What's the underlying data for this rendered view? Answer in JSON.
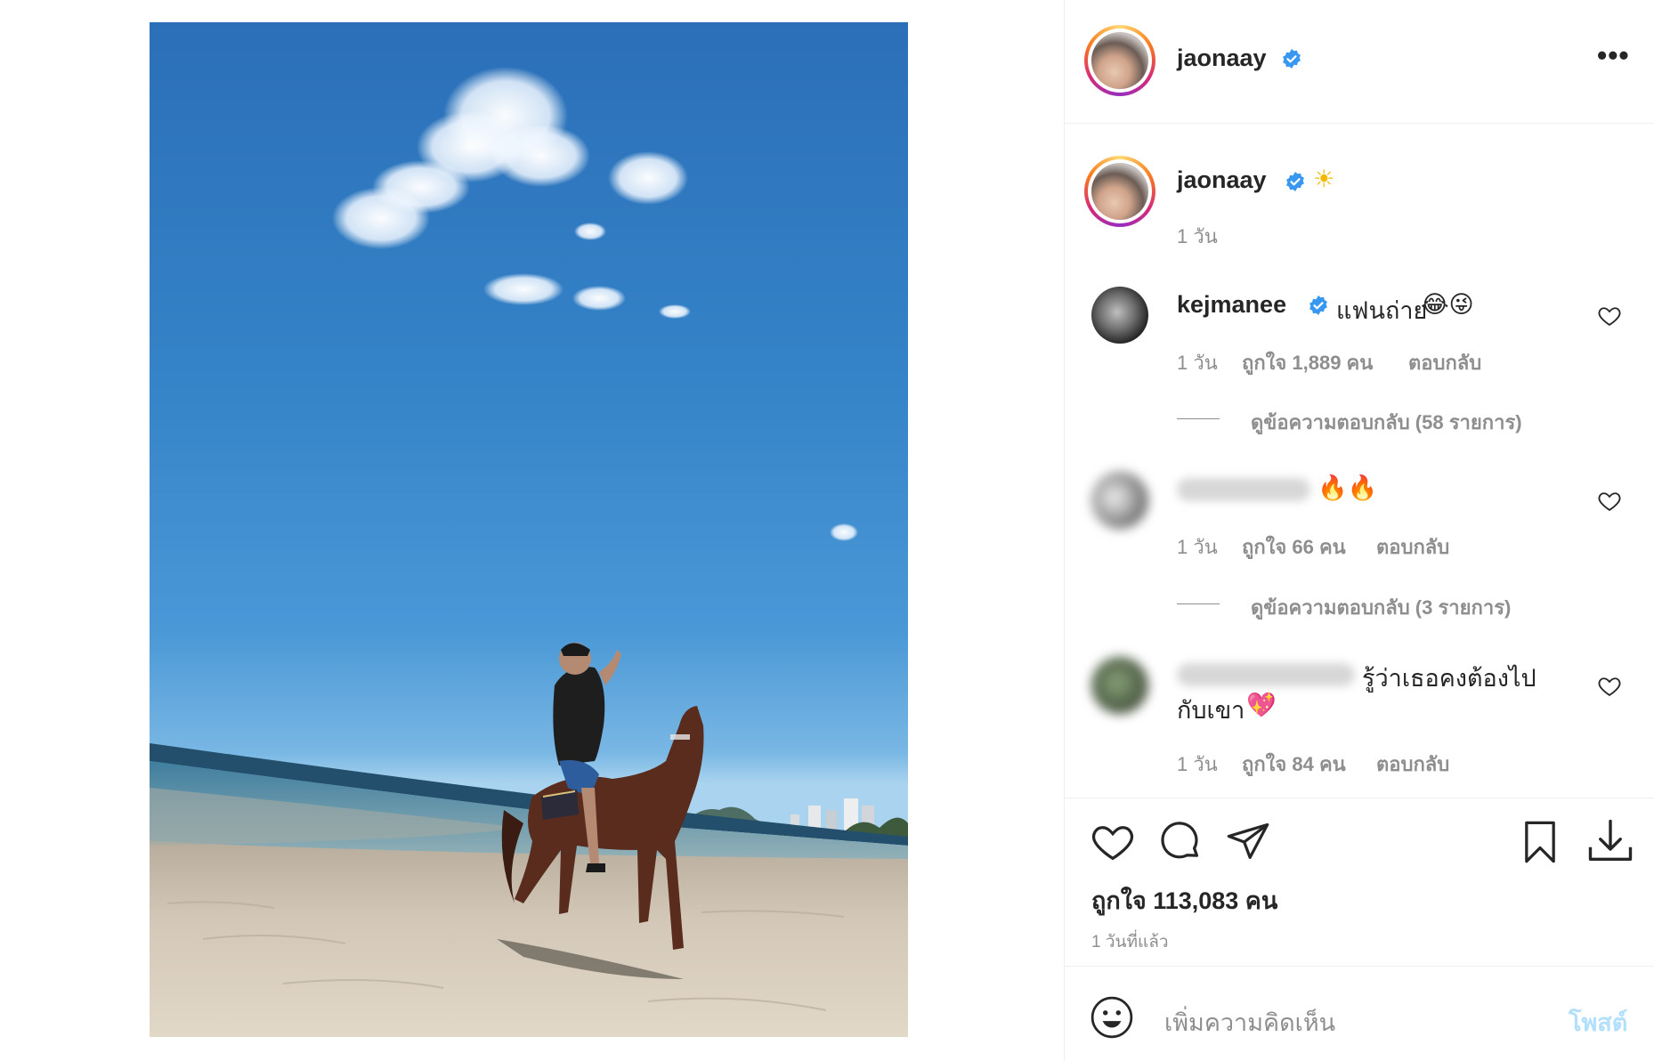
{
  "post": {
    "author": "jaonaay",
    "caption_emoji": "☀",
    "caption_time": "1 วัน",
    "more_label": "•••"
  },
  "comments": [
    {
      "user": "kejmanee",
      "text": "แฟนถ่าย",
      "emoji": "😂😜",
      "time": "1 วัน",
      "likes": "ถูกใจ 1,889 คน",
      "reply_label": "ตอบกลับ",
      "view_replies": "ดูข้อความตอบกลับ (58 รายการ)"
    },
    {
      "emoji": "🔥🔥",
      "time": "1 วัน",
      "likes": "ถูกใจ 66 คน",
      "reply_label": "ตอบกลับ",
      "view_replies": "ดูข้อความตอบกลับ (3 รายการ)"
    },
    {
      "text_line1": "รู้ว่าเธอคงต้องไป",
      "text_line2": "กับเขา",
      "emoji": "💖",
      "time": "1 วัน",
      "likes": "ถูกใจ 84 คน",
      "reply_label": "ตอบกลับ"
    }
  ],
  "actions": {
    "icons": [
      "heart-icon",
      "comment-icon",
      "share-icon",
      "bookmark-icon",
      "download-icon"
    ]
  },
  "summary": {
    "likes": "ถูกใจ 113,083 คน",
    "time": "1 วันที่แล้ว"
  },
  "composer": {
    "placeholder": "เพิ่มความคิดเห็น",
    "post_label": "โพสต์"
  },
  "colors": {
    "verified": "#3897f0",
    "post_button_disabled": "#b2dffc",
    "muted_text": "#8e8e8e"
  }
}
